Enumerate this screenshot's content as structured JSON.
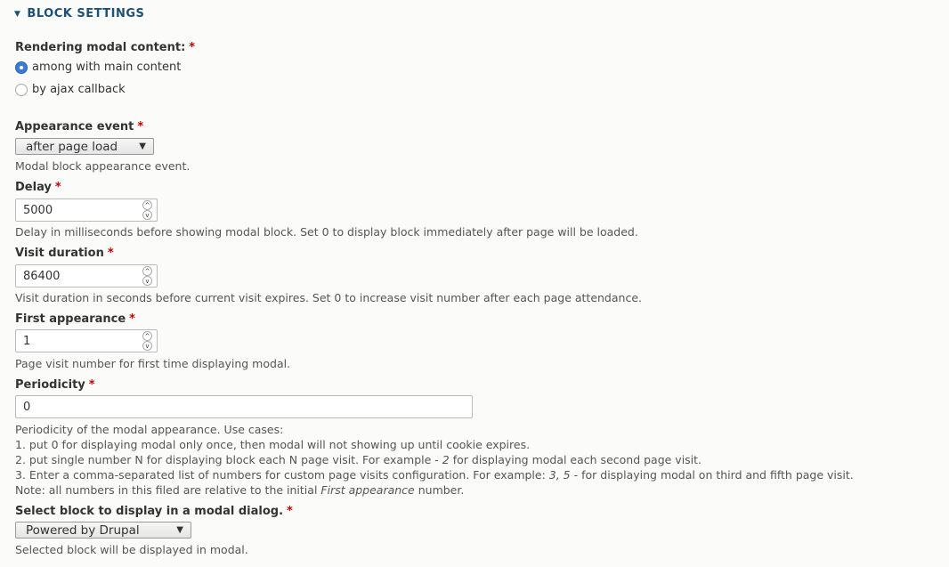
{
  "section": {
    "title": "BLOCK SETTINGS",
    "expanded": true
  },
  "rendering": {
    "label": "Rendering modal content:",
    "required_mark": "*",
    "options": [
      {
        "label": "among with main content",
        "checked": true
      },
      {
        "label": "by ajax callback",
        "checked": false
      }
    ]
  },
  "appearance_event": {
    "label": "Appearance event",
    "required_mark": "*",
    "selected": "after page load",
    "description": "Modal block appearance event."
  },
  "delay": {
    "label": "Delay",
    "required_mark": "*",
    "value": "5000",
    "description": "Delay in milliseconds before showing modal block. Set 0 to display block immediately after page will be loaded."
  },
  "visit_duration": {
    "label": "Visit duration",
    "required_mark": "*",
    "value": "86400",
    "description": "Visit duration in seconds before current visit expires. Set 0 to increase visit number after each page attendance."
  },
  "first_appearance": {
    "label": "First appearance",
    "required_mark": "*",
    "value": "1",
    "description": "Page visit number for first time displaying modal."
  },
  "periodicity": {
    "label": "Periodicity",
    "required_mark": "*",
    "value": "0",
    "description": {
      "intro": "Periodicity of the modal appearance. Use cases:",
      "case1": "1. put 0 for displaying modal only once, then modal will not showing up until cookie expires.",
      "case2_pre": "2. put single number N for displaying block each N page visit. For example - ",
      "case2_em": "2",
      "case2_post": " for displaying modal each second page visit.",
      "case3_pre": "3. Enter a comma-separated list of numbers for custom page visits configuration. For example: ",
      "case3_em": "3, 5",
      "case3_post": " - for displaying modal on third and fifth page visit.",
      "note_pre": "Note: all numbers in this filed are relative to the initial ",
      "note_em": "First appearance",
      "note_post": " number."
    }
  },
  "block_select": {
    "label": "Select block to display in a modal dialog.",
    "required_mark": "*",
    "selected": "Powered by Drupal",
    "description": "Selected block will be displayed in modal."
  },
  "icons": {
    "collapse": "▼",
    "dropdown": "▼",
    "spin_up": "^",
    "spin_down": "v"
  }
}
